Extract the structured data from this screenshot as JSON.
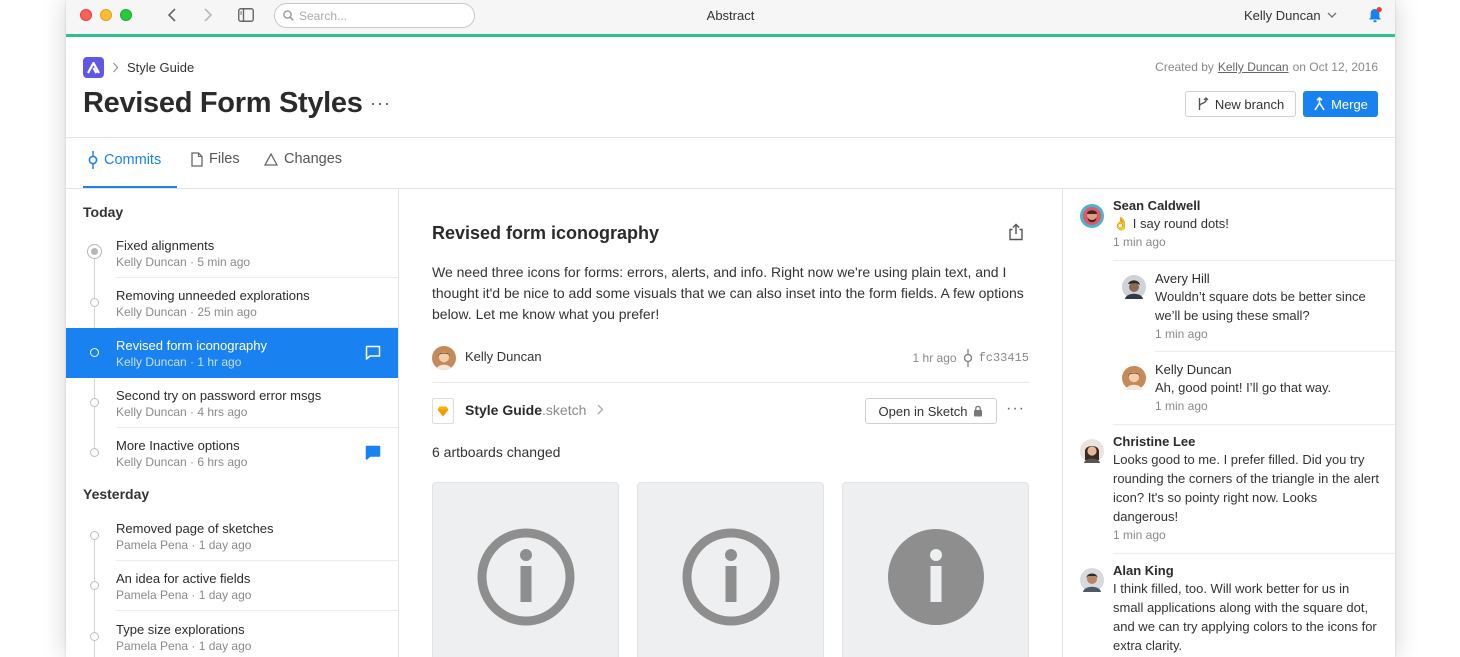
{
  "window": {
    "title": "Abstract",
    "search_placeholder": "Search...",
    "user_name": "Kelly Duncan",
    "accent_color": "#2fc08f"
  },
  "header": {
    "breadcrumb": "Style Guide",
    "created_prefix": "Created by",
    "created_by": "Kelly Duncan",
    "created_suffix": "on Oct 12, 2016",
    "title": "Revised Form Styles",
    "more": "···",
    "new_branch_label": "New branch",
    "merge_label": "Merge",
    "brand_color": "#5f58e6",
    "primary_color": "#1a82f0"
  },
  "tabs": [
    {
      "label": "Commits",
      "icon": "commit-icon",
      "active": true
    },
    {
      "label": "Files",
      "icon": "file-icon",
      "active": false
    },
    {
      "label": "Changes",
      "icon": "triangle-icon",
      "active": false
    }
  ],
  "commits": {
    "today_label": "Today",
    "yesterday_label": "Yesterday",
    "today": [
      {
        "title": "Fixed alignments",
        "meta": "Kelly Duncan · 5 min ago",
        "comment_icon": "none"
      },
      {
        "title": "Removing unneeded explorations",
        "meta": "Kelly Duncan · 25 min ago",
        "comment_icon": "none"
      },
      {
        "title": "Revised form iconography",
        "meta": "Kelly Duncan · 1 hr ago",
        "comment_icon": "outline",
        "selected": true
      },
      {
        "title": "Second try on password error msgs",
        "meta": "Kelly Duncan · 4 hrs ago",
        "comment_icon": "none"
      },
      {
        "title": "More Inactive options",
        "meta": "Kelly Duncan · 6 hrs ago",
        "comment_icon": "filled"
      }
    ],
    "yesterday": [
      {
        "title": "Removed page of sketches",
        "meta": "Pamela Pena · 1 day ago"
      },
      {
        "title": "An idea for active fields",
        "meta": "Pamela Pena · 1 day ago"
      },
      {
        "title": "Type size explorations",
        "meta": "Pamela Pena · 1 day ago"
      }
    ]
  },
  "detail": {
    "title": "Revised form iconography",
    "body": "We need three icons for forms: errors, alerts, and info. Right now we're using plain text, and I thought it'd be nice to add some visuals that we can also inset into the form fields. A few options below. Let me know what you prefer!",
    "author": "Kelly Duncan",
    "time": "1 hr ago",
    "sha": "fc33415",
    "file_name": "Style Guide",
    "file_ext": ".sketch",
    "open_label": "Open in Sketch",
    "more": "···",
    "artboards_label": "6 artboards changed",
    "artboards": [
      {
        "icon": "info-outline-icon"
      },
      {
        "icon": "info-outline-icon"
      },
      {
        "icon": "info-filled-icon"
      }
    ]
  },
  "comments": [
    {
      "name": "Sean Caldwell",
      "text": "👌 I say round dots!",
      "time": "1 min ago",
      "reply": false
    },
    {
      "name": "Avery Hill",
      "text": "Wouldn’t square dots be better since we’ll be using these small?",
      "time": "1 min ago",
      "reply": true
    },
    {
      "name": "Kelly Duncan",
      "text": "Ah, good point! I’ll go that way.",
      "time": "1 min ago",
      "reply": true
    },
    {
      "name": "Christine Lee",
      "text": "Looks good to me. I prefer filled. Did you try rounding the corners of the triangle in the alert icon? It's so pointy right now. Looks dangerous!",
      "time": "1 min ago",
      "reply": false
    },
    {
      "name": "Alan King",
      "text": "I think filled, too. Will work better for us in small applications along with the square dot, and we can try applying colors to the icons for extra clarity.",
      "time": "",
      "reply": false
    }
  ]
}
